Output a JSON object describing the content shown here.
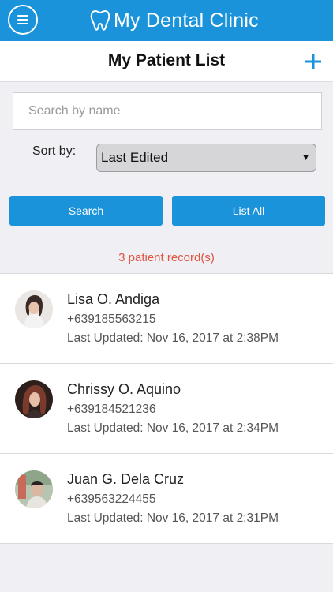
{
  "header": {
    "brand": "My Dental Clinic",
    "menu_icon": "hamburger-icon",
    "logo_icon": "tooth-icon",
    "accent_color": "#1a93db"
  },
  "titlebar": {
    "title": "My Patient List",
    "add_icon": "plus-icon"
  },
  "search": {
    "placeholder": "Search by name",
    "value": ""
  },
  "sort": {
    "label": "Sort by:",
    "selected": "Last Edited"
  },
  "buttons": {
    "search": "Search",
    "list_all": "List All"
  },
  "record_count": "3 patient record(s)",
  "patients": [
    {
      "name": "Lisa O. Andiga",
      "phone": "+639185563215",
      "updated": "Last Updated: Nov 16, 2017 at 2:38PM"
    },
    {
      "name": "Chrissy O. Aquino",
      "phone": "+639184521236",
      "updated": "Last Updated: Nov 16, 2017 at 2:34PM"
    },
    {
      "name": "Juan G. Dela Cruz",
      "phone": "+639563224455",
      "updated": "Last Updated: Nov 16, 2017 at 2:31PM"
    }
  ]
}
